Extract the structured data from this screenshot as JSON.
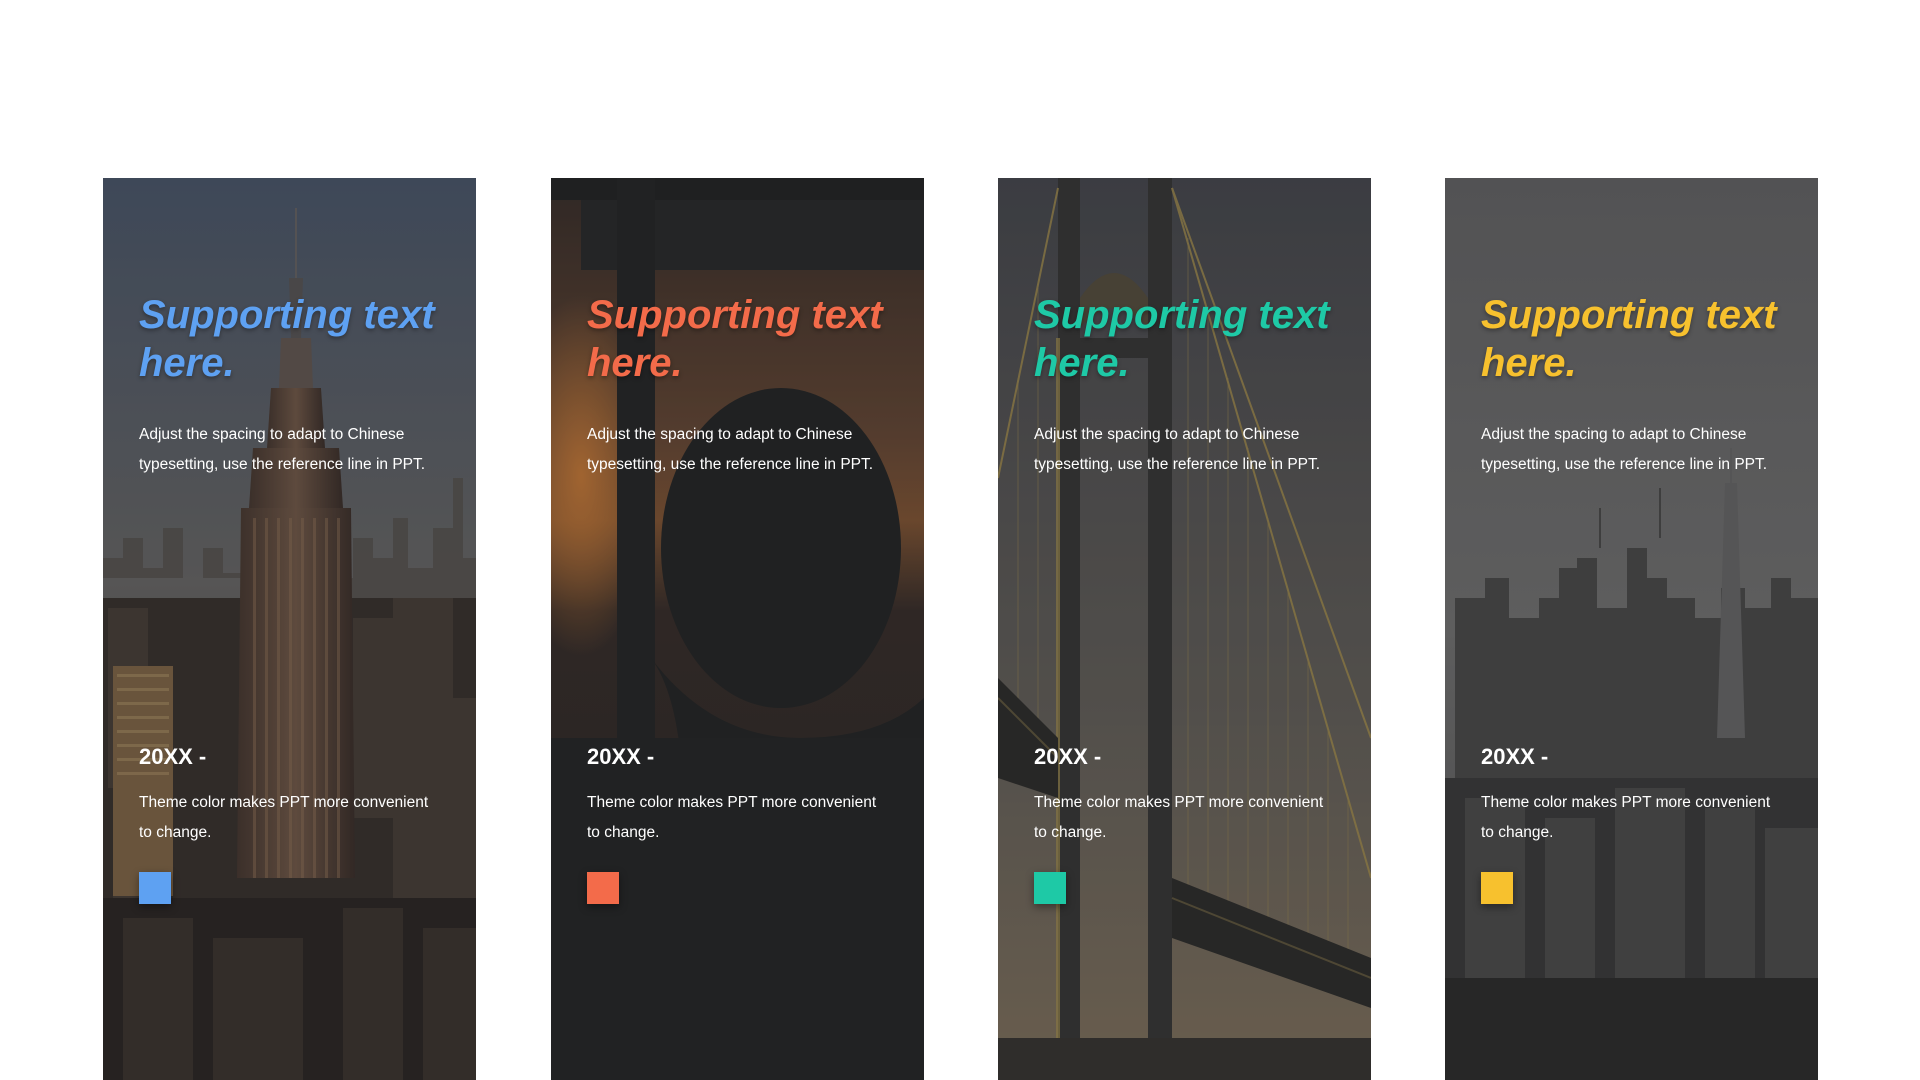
{
  "cards": [
    {
      "heading": "Supporting text here.",
      "body": "Adjust the spacing to adapt to Chinese typesetting, use the reference line in PPT.",
      "year": "20XX -",
      "caption": "Theme color makes PPT more convenient to change.",
      "accent": "#5ea1f2",
      "photo_icon": "skyscraper-photo"
    },
    {
      "heading": "Supporting text here.",
      "body": "Adjust the spacing to adapt to Chinese typesetting, use the reference line in PPT.",
      "year": "20XX -",
      "caption": "Theme color makes PPT more convenient to change.",
      "accent": "#f36b4a",
      "photo_icon": "person-silhouette-photo"
    },
    {
      "heading": "Supporting text here.",
      "body": "Adjust the spacing to adapt to Chinese typesetting, use the reference line in PPT.",
      "year": "20XX -",
      "caption": "Theme color makes PPT more convenient to change.",
      "accent": "#1ec9a6",
      "photo_icon": "bridge-photo"
    },
    {
      "heading": "Supporting text here.",
      "body": "Adjust the spacing to adapt to Chinese typesetting, use the reference line in PPT.",
      "year": "20XX -",
      "caption": "Theme color makes PPT more convenient to change.",
      "accent": "#f7c12e",
      "photo_icon": "city-skyline-photo"
    }
  ]
}
